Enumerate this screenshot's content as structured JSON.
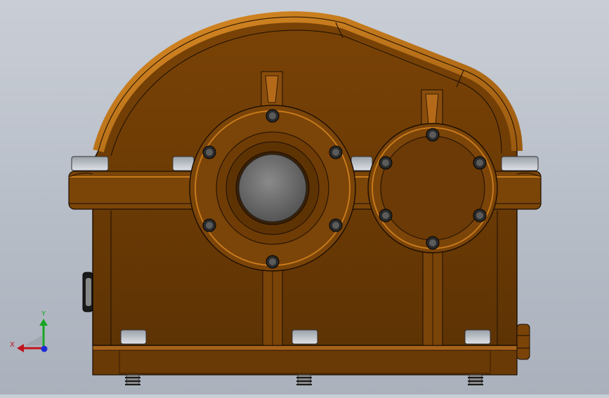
{
  "viewport": {
    "view_orientation": "front",
    "model": {
      "type": "gearbox-housing",
      "body_color": "#6b3a05",
      "edge_color": "#1a0e02",
      "highlight_color": "#c67a1c",
      "bolt_color": "#2a2a2a",
      "lens_color": "#6c6c6c"
    }
  },
  "triad": {
    "x_label": "X",
    "y_label": "Y",
    "x_color": "#c0141e",
    "y_color": "#19a524",
    "z_color": "#1c2bd6"
  }
}
